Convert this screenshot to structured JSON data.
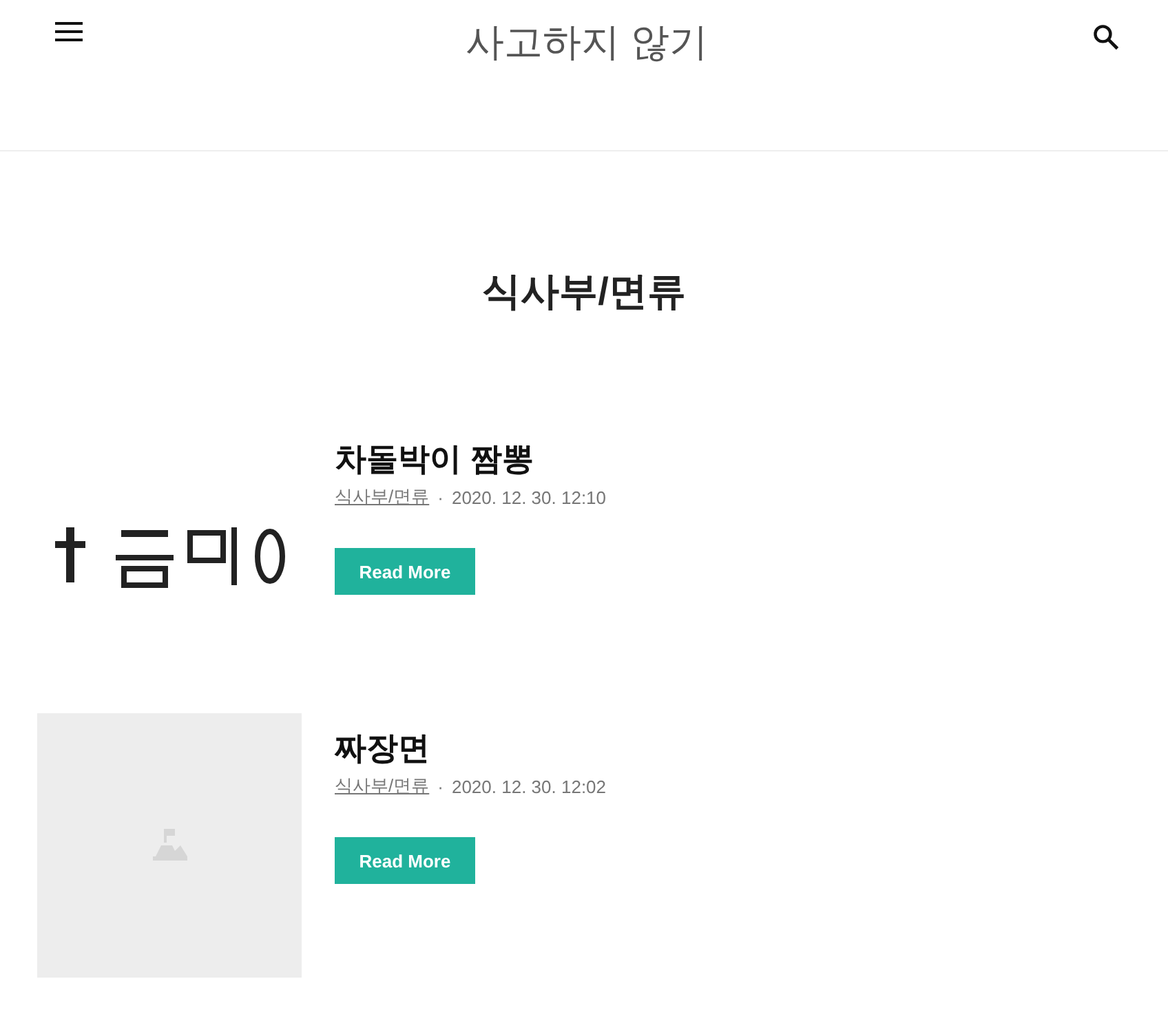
{
  "header": {
    "site_title": "사고하지 않기"
  },
  "category_title": "식사부/면류",
  "posts": [
    {
      "title": "차돌박이 짬뽕",
      "category": "식사부/면류",
      "separator": "·",
      "date": "2020. 12. 30. 12:10",
      "button": "Read More"
    },
    {
      "title": "짜장면",
      "category": "식사부/면류",
      "separator": "·",
      "date": "2020. 12. 30. 12:02",
      "button": "Read More",
      "thumbnail": {
        "kind": "placeholder"
      }
    }
  ]
}
